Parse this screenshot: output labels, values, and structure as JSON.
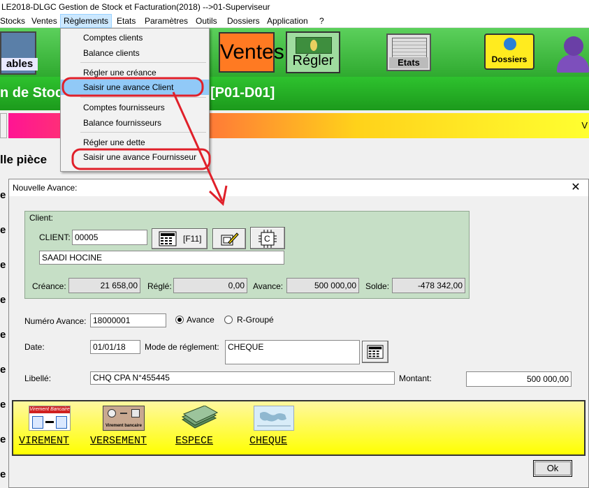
{
  "window": {
    "title": "LE2018-DLGC Gestion de Stock et Facturation(2018) -->01-Superviseur"
  },
  "menubar": {
    "items": [
      "Stocks",
      "Ventes",
      "Règlements",
      "Etats",
      "Paramètres",
      "Outils",
      "Dossiers",
      "Application",
      "?"
    ]
  },
  "toolbar": {
    "first_label": "ables",
    "ventes_label": "Ventes",
    "regler_label": "Régler",
    "etats_label": "Etats",
    "dossiers_label": "Dossiers"
  },
  "band": {
    "left_text": "n de Stoc",
    "right_text": "[P01-D01]"
  },
  "strip": {
    "right_char": "V"
  },
  "piece_label": "lle pièce",
  "side_letter": "e",
  "dropdown": {
    "items": [
      "Comptes clients",
      "Balance clients",
      "Régler une créance",
      "Saisir une avance Client",
      "Comptes fournisseurs",
      "Balance fournisseurs",
      "Régler une dette",
      "Saisir une avance Fournisseur"
    ]
  },
  "dialog": {
    "title": "Nouvelle Avance:",
    "close": "✕",
    "client_legend": "Client:",
    "client_label": "CLIENT:",
    "client_code": "00005",
    "f11_label": "[F11]",
    "c_label": "C",
    "client_name": "SAADI HOCINE",
    "creance_label": "Créance:",
    "creance_value": "21 658,00",
    "regle_label": "Réglé:",
    "regle_value": "0,00",
    "avance_label": "Avance:",
    "avance_value": "500 000,00",
    "solde_label": "Solde:",
    "solde_value": "-478 342,00",
    "numero_label": "Numéro Avance:",
    "numero_value": "18000001",
    "radio_avance": "Avance",
    "radio_groupe": "R-Groupé",
    "date_label": "Date:",
    "date_value": "01/01/18",
    "mode_label": "Mode de réglement:",
    "mode_value": "CHEQUE",
    "libelle_label": "Libellé:",
    "libelle_value": "CHQ CPA N°455445",
    "montant_label": "Montant:",
    "montant_value": "500 000,00",
    "pay": {
      "virement": "VIREMENT",
      "versement": "VERSEMENT",
      "espece": "ESPECE",
      "cheque": "CHEQUE",
      "virement_icon_text": "Virement Bancaire",
      "versement_icon_text": "Virement bancaire"
    },
    "ok": "Ok"
  },
  "colors": {
    "toolbar_green": "#2faa2f",
    "highlight": "#91c9f7",
    "annotation_red": "#e0202a",
    "pay_band": "#ffff00"
  }
}
